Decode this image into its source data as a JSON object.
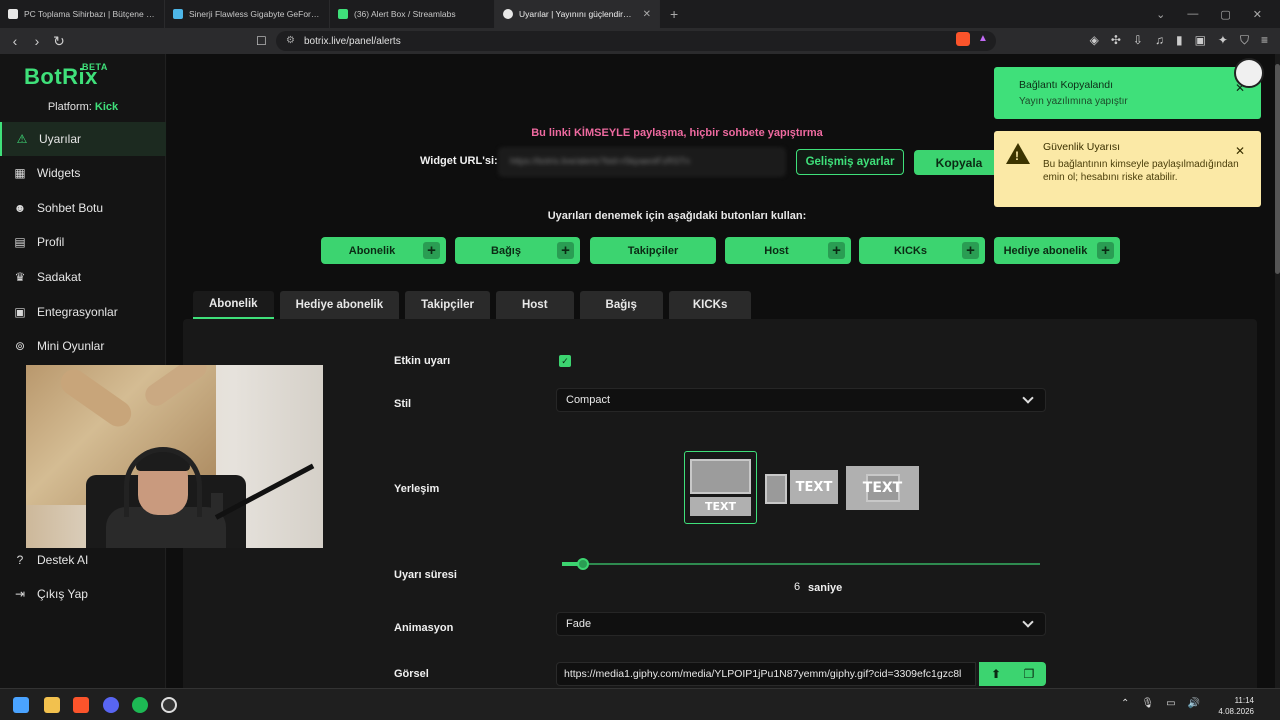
{
  "browser": {
    "tabs": [
      {
        "title": "PC Toplama Sihirbazı | Bütçene Göre",
        "color": "#e8e8e8"
      },
      {
        "title": "Sinerji Flawless Gigabyte GeForce R",
        "color": "#4db6e8"
      },
      {
        "title": "(36) Alert Box / Streamlabs",
        "color": "#3fe07a"
      },
      {
        "title": "Uyarılar | Yayınını güçlendirmek",
        "color": "#e8e8e8"
      }
    ],
    "url": "botrix.live/panel/alerts"
  },
  "sidebar": {
    "logo": "BotRix",
    "beta": "BETA",
    "platform_label": "Platform:",
    "platform_value": "Kick",
    "items": [
      {
        "label": "Uyarılar",
        "icon": "warning-icon"
      },
      {
        "label": "Widgets",
        "icon": "grid-icon"
      },
      {
        "label": "Sohbet Botu",
        "icon": "robot-icon"
      },
      {
        "label": "Profil",
        "icon": "id-card-icon"
      },
      {
        "label": "Sadakat",
        "icon": "trophy-icon"
      },
      {
        "label": "Entegrasyonlar",
        "icon": "integration-icon"
      },
      {
        "label": "Mini Oyunlar",
        "icon": "gamepad-icon"
      },
      {
        "label": "Destek AI",
        "icon": "help-icon"
      },
      {
        "label": "Çıkış Yap",
        "icon": "logout-icon"
      }
    ]
  },
  "main": {
    "warning": "Bu linki KİMSEYLE paylaşma, hiçbir sohbete yapıştırma",
    "widget_url_label": "Widget URL'si:",
    "widget_url_value": "https://botrix.live/alerts?bid=r5kpaeotFzRSTn",
    "advanced_button": "Gelişmiş ayarlar",
    "copy_button": "Kopyala",
    "try_text": "Uyarıları denemek için aşağıdaki butonları kullan:",
    "try_buttons": [
      "Abonelik",
      "Bağış",
      "Takipçiler",
      "Host",
      "KICKs",
      "Hediye abonelik"
    ],
    "tabs": [
      "Abonelik",
      "Hediye abonelik",
      "Takipçiler",
      "Host",
      "Bağış",
      "KICKs"
    ],
    "active_tab": "Abonelik",
    "fields": {
      "enabled_label": "Etkin uyarı",
      "enabled": true,
      "style_label": "Stil",
      "style_value": "Compact",
      "layout_label": "Yerleşim",
      "layout_text": "TEXT",
      "duration_label": "Uyarı süresi",
      "duration_value": "6",
      "duration_unit": "saniye",
      "duration_fraction": 0.04,
      "animation_label": "Animasyon",
      "animation_value": "Fade",
      "image_label": "Görsel",
      "image_value": "https://media1.giphy.com/media/YLPOIP1jPu1N87yemm/giphy.gif?cid=3309efc1gzc8l"
    }
  },
  "toasts": {
    "ok_title": "Bağlantı Kopyalandı",
    "ok_body": "Yayın yazılımına yapıştır",
    "warn_title": "Güvenlik Uyarısı",
    "warn_body": "Bu bağlantının kimseyle paylaşılmadığından emin ol; hesabını riske atabilir."
  },
  "taskbar": {
    "time": "11:14",
    "date": "4.08.2026"
  },
  "colors": {
    "accent": "#3cd470",
    "warning_text": "#ef6aa0"
  }
}
